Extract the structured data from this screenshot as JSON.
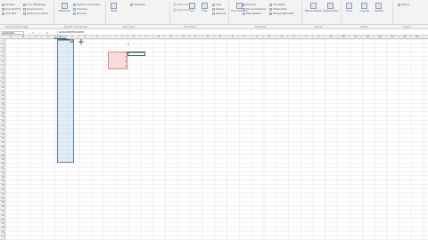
{
  "ribbon": {
    "left_items": [
      "Get Data",
      "From Text/CSV",
      "From Web",
      "From Table/Range",
      "Recent Sources",
      "Existing Connections"
    ],
    "refresh_label": "Refresh All",
    "query_items": [
      "Queries & Connections",
      "Properties",
      "Edit Links"
    ],
    "stock_items": [
      "Stocks",
      "Geography"
    ],
    "sort_items": [
      "Sort A to Z",
      "Sort Z to A",
      "Sort"
    ],
    "filter_items": [
      "Filter",
      "Clear",
      "Reapply",
      "Advanced"
    ],
    "tools_items": [
      "Text to Columns",
      "Flash Fill",
      "Remove Duplicates",
      "Data Validation",
      "Consolidate",
      "Relationships",
      "Manage Data Model"
    ],
    "forecast_items": [
      "What-If Analysis",
      "Forecast Sheet"
    ],
    "outline_items": [
      "Group",
      "Ungroup",
      "Subtotal"
    ],
    "analyze_label": "Analyze",
    "group_labels": [
      "Get & Transform Data",
      "Queries & Connections",
      "Data Types",
      "Sort & Filter",
      "Data Tools",
      "Forecast",
      "Outline",
      "Analyze"
    ]
  },
  "formula_bar": {
    "name_box": "ab012345",
    "fx_buttons": "✕ ✓",
    "fx": "fx",
    "value": "ab0123456780123456"
  },
  "columns": [
    "A",
    "B",
    "C",
    "D",
    "E",
    "F",
    "G",
    "H",
    "I",
    "J",
    "K",
    "L",
    "M",
    "N",
    "O",
    "P",
    "Q",
    "R",
    "S",
    "T",
    "U",
    "V",
    "W",
    "X",
    "Y",
    "Z",
    "AA",
    "AB",
    "AC",
    "AD",
    "AE",
    "AF",
    "AG",
    "AH"
  ],
  "rows": [
    "1",
    "2",
    "3",
    "4",
    "5",
    "6",
    "7",
    "8",
    "9",
    "10",
    "11",
    "12",
    "13",
    "14",
    "15",
    "16",
    "17",
    "18",
    "19",
    "20",
    "21",
    "22",
    "23",
    "24",
    "25",
    "26",
    "27",
    "28",
    "29",
    "30",
    "31",
    "32",
    "33",
    "34",
    "35",
    "36",
    "37",
    "38",
    "39",
    "40",
    "41",
    "42",
    "43",
    "44",
    "45",
    "46",
    "47"
  ],
  "cells": {
    "e1": "ab0123456",
    "i1_value": "0",
    "i3_value": "ab0123456780",
    "red_values": [
      "1",
      "2",
      "3",
      "4"
    ]
  },
  "colors": {
    "accent": "#217346",
    "selection_border": "#5a7fb5",
    "red_fill": "#f8dcdc"
  },
  "icons": [
    "filter-dropdown-icon",
    "cursor-icon"
  ]
}
